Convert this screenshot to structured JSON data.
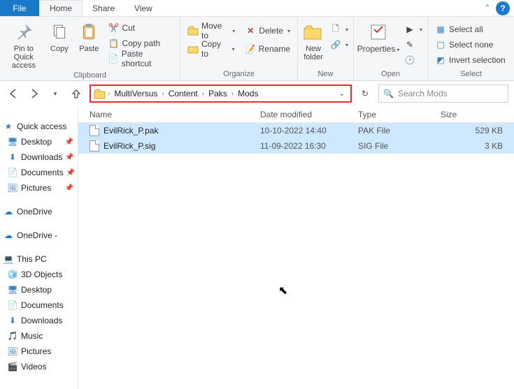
{
  "tabs": {
    "file": "File",
    "home": "Home",
    "share": "Share",
    "view": "View"
  },
  "ribbon": {
    "clipboard": {
      "pin": "Pin to Quick access",
      "copy": "Copy",
      "paste": "Paste",
      "cut": "Cut",
      "copy_path": "Copy path",
      "paste_shortcut": "Paste shortcut",
      "title": "Clipboard"
    },
    "organize": {
      "move": "Move to",
      "copy": "Copy to",
      "delete": "Delete",
      "rename": "Rename",
      "title": "Organize"
    },
    "new": {
      "folder": "New folder",
      "title": "New"
    },
    "open": {
      "properties": "Properties",
      "title": "Open"
    },
    "select": {
      "all": "Select all",
      "none": "Select none",
      "invert": "Invert selection",
      "title": "Select"
    }
  },
  "breadcrumb": [
    "MultiVersus",
    "Content",
    "Paks",
    "Mods"
  ],
  "search": {
    "placeholder": "Search Mods"
  },
  "columns": {
    "name": "Name",
    "date": "Date modified",
    "type": "Type",
    "size": "Size"
  },
  "files": [
    {
      "name": "EvilRick_P.pak",
      "date": "10-10-2022 14:40",
      "type": "PAK File",
      "size": "529 KB"
    },
    {
      "name": "EvilRick_P.sig",
      "date": "11-09-2022 16:30",
      "type": "SIG File",
      "size": "3 KB"
    }
  ],
  "sidebar": {
    "quick": {
      "label": "Quick access",
      "items": [
        "Desktop",
        "Downloads",
        "Documents",
        "Pictures"
      ]
    },
    "onedrive1": "OneDrive",
    "onedrive2": "OneDrive - ",
    "thispc": {
      "label": "This PC",
      "items": [
        "3D Objects",
        "Desktop",
        "Documents",
        "Downloads",
        "Music",
        "Pictures",
        "Videos"
      ]
    }
  }
}
